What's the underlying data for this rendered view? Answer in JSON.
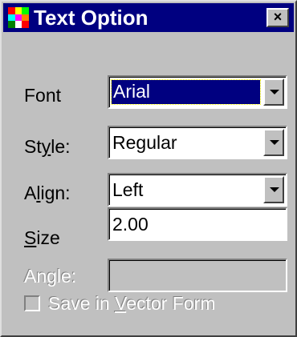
{
  "window": {
    "title": "Text Option",
    "close_label": "×"
  },
  "form": {
    "font": {
      "label_pre": "",
      "label_u": "",
      "label_post": "Font",
      "value": "Arial"
    },
    "style": {
      "label_pre": "St",
      "label_u": "y",
      "label_post": "le:",
      "value": "Regular"
    },
    "align": {
      "label_pre": "A",
      "label_u": "l",
      "label_post": "ign:",
      "value": "Left"
    },
    "size": {
      "label_pre": "",
      "label_u": "S",
      "label_post": "ize",
      "value": "2.00"
    },
    "angle": {
      "label_pre": "",
      "label_u": "",
      "label_post": "Angle:",
      "value": ""
    },
    "vector": {
      "label_pre": "Save in ",
      "label_u": "V",
      "label_post": "ector Form",
      "checked": false
    }
  },
  "colors": {
    "title_bar": "#000080",
    "dialog_face": "#c0c0c0",
    "selection": "#000080"
  }
}
